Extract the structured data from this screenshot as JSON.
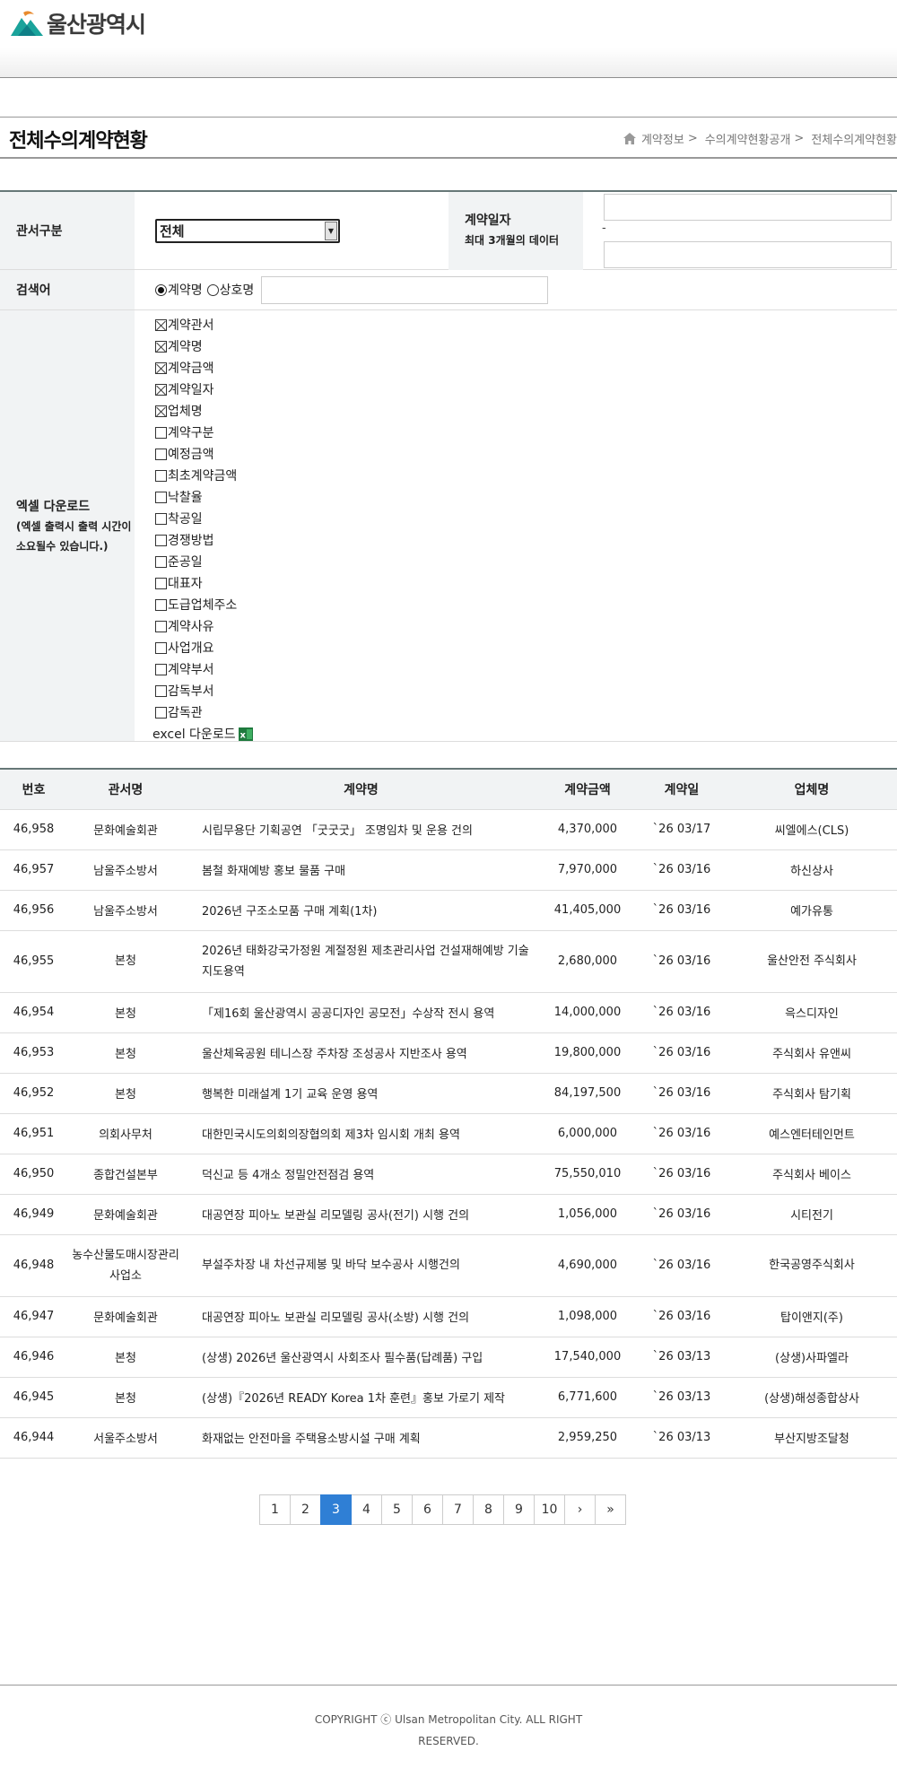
{
  "header": {
    "logo_text": "울산광역시"
  },
  "page": {
    "title": "전체수의계약현황"
  },
  "breadcrumb": [
    {
      "label": "계약정보"
    },
    {
      "label": "수의계약현황공개"
    },
    {
      "label": "전체수의계약현황"
    }
  ],
  "breadcrumb_sep": ">",
  "search": {
    "office_label": "관서구분",
    "office_value": "전체",
    "date_label": "계약일자",
    "date_sub": "최대 3개월의 데이터",
    "date_dash": "-",
    "keyword_label": "검색어",
    "radio_contract": "계약명",
    "radio_company": "상호명"
  },
  "excel": {
    "label": "엑셀 다운로드",
    "sub": "(엑셀 출력시 출력 시간이 소요될수 있습니다.)",
    "items": [
      {
        "label": "계약관서",
        "checked": true
      },
      {
        "label": "계약명",
        "checked": true
      },
      {
        "label": "계약금액",
        "checked": true
      },
      {
        "label": "계약일자",
        "checked": true
      },
      {
        "label": "업체명",
        "checked": true
      },
      {
        "label": "계약구분",
        "checked": false
      },
      {
        "label": "예정금액",
        "checked": false
      },
      {
        "label": "최초계약금액",
        "checked": false
      },
      {
        "label": "낙찰율",
        "checked": false
      },
      {
        "label": "착공일",
        "checked": false
      },
      {
        "label": "경쟁방법",
        "checked": false
      },
      {
        "label": "준공일",
        "checked": false
      },
      {
        "label": "대표자",
        "checked": false
      },
      {
        "label": "도급업체주소",
        "checked": false
      },
      {
        "label": "계약사유",
        "checked": false
      },
      {
        "label": "사업개요",
        "checked": false
      },
      {
        "label": "계약부서",
        "checked": false
      },
      {
        "label": "감독부서",
        "checked": false
      },
      {
        "label": "감독관",
        "checked": false
      }
    ],
    "download_label": "excel 다운로드"
  },
  "table": {
    "headers": [
      "번호",
      "관서명",
      "계약명",
      "계약금액",
      "계약일",
      "업체명"
    ],
    "rows": [
      {
        "no": "46,958",
        "office": "문화예술회관",
        "name": "시립무용단 기획공연 「굿굿굿」 조명임차 및 운용 건의",
        "amount": "4,370,000",
        "date": "`26 03/17",
        "company": "씨엘에스(CLS)"
      },
      {
        "no": "46,957",
        "office": "남울주소방서",
        "name": "봄철 화재예방 홍보 물품 구매",
        "amount": "7,970,000",
        "date": "`26 03/16",
        "company": "하신상사"
      },
      {
        "no": "46,956",
        "office": "남울주소방서",
        "name": "2026년 구조소모품 구매 계획(1차)",
        "amount": "41,405,000",
        "date": "`26 03/16",
        "company": "예가유통"
      },
      {
        "no": "46,955",
        "office": "본청",
        "name": "2026년 태화강국가정원 계절정원 제초관리사업 건설재해예방 기술지도용역",
        "amount": "2,680,000",
        "date": "`26 03/16",
        "company": "울산안전 주식회사",
        "tall": true
      },
      {
        "no": "46,954",
        "office": "본청",
        "name": "「제16회 울산광역시 공공디자인 공모전」수상작 전시 용역",
        "amount": "14,000,000",
        "date": "`26 03/16",
        "company": "윽스디자인"
      },
      {
        "no": "46,953",
        "office": "본청",
        "name": "울산체육공원 테니스장 주차장 조성공사 지반조사 용역",
        "amount": "19,800,000",
        "date": "`26 03/16",
        "company": "주식회사 유앤씨"
      },
      {
        "no": "46,952",
        "office": "본청",
        "name": "행복한 미래설계 1기 교육 운영 용역",
        "amount": "84,197,500",
        "date": "`26 03/16",
        "company": "주식회사 탐기획"
      },
      {
        "no": "46,951",
        "office": "의회사무처",
        "name": "대한민국시도의회의장협의회 제3차 임시회 개최 용역",
        "amount": "6,000,000",
        "date": "`26 03/16",
        "company": "예스엔터테인먼트"
      },
      {
        "no": "46,950",
        "office": "종합건설본부",
        "name": "덕신교 등 4개소 정밀안전점검 용역",
        "amount": "75,550,010",
        "date": "`26 03/16",
        "company": "주식회사 베이스"
      },
      {
        "no": "46,949",
        "office": "문화예술회관",
        "name": "대공연장 피아노 보관실 리모델링 공사(전기) 시행 건의",
        "amount": "1,056,000",
        "date": "`26 03/16",
        "company": "시티전기"
      },
      {
        "no": "46,948",
        "office": "농수산물도매시장관리사업소",
        "name": "부설주차장 내 차선규제봉 및 바닥 보수공사 시행건의",
        "amount": "4,690,000",
        "date": "`26 03/16",
        "company": "한국공영주식회사",
        "tall": true
      },
      {
        "no": "46,947",
        "office": "문화예술회관",
        "name": "대공연장 피아노 보관실 리모델링 공사(소방) 시행 건의",
        "amount": "1,098,000",
        "date": "`26 03/16",
        "company": "탑이앤지(주)"
      },
      {
        "no": "46,946",
        "office": "본청",
        "name": "(상생) 2026년 울산광역시 사회조사 필수품(답례품) 구입",
        "amount": "17,540,000",
        "date": "`26 03/13",
        "company": "(상생)사파엘라"
      },
      {
        "no": "46,945",
        "office": "본청",
        "name": "(상생)『2026년 READY Korea 1차 훈련』홍보 가로기 제작",
        "amount": "6,771,600",
        "date": "`26 03/13",
        "company": "(상생)해성종합상사"
      },
      {
        "no": "46,944",
        "office": "서울주소방서",
        "name": "화재없는 안전마을 주택용소방시설 구매 계획",
        "amount": "2,959,250",
        "date": "`26 03/13",
        "company": "부산지방조달청"
      }
    ]
  },
  "pagination": {
    "pages": [
      "1",
      "2",
      "3",
      "4",
      "5",
      "6",
      "7",
      "8",
      "9",
      "10"
    ],
    "current": "3",
    "next": "›",
    "last": "»"
  },
  "footer": {
    "copyright": "COPYRIGHT ⓒ Ulsan Metropolitan City. ALL RIGHT RESERVED."
  },
  "colors": {
    "accent": "#2f7fd5",
    "label_bg": "#f1f3f4",
    "logo_teal": "#1aa39b"
  }
}
